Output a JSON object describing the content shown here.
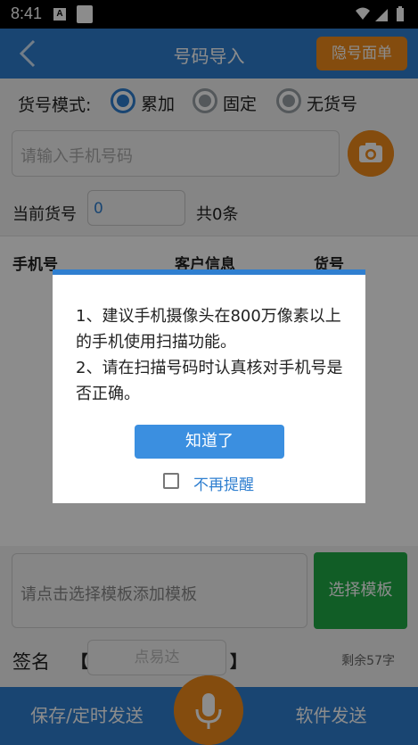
{
  "status_bar": {
    "time": "8:41",
    "notification_letter": "A"
  },
  "header": {
    "title": "号码导入",
    "hide_button": "隐号面单"
  },
  "mode": {
    "label": "货号模式:",
    "options": [
      {
        "label": "累加",
        "checked": true
      },
      {
        "label": "固定",
        "checked": false
      },
      {
        "label": "无货号",
        "checked": false
      }
    ]
  },
  "phone": {
    "placeholder": "请输入手机号码"
  },
  "goods": {
    "label": "当前货号",
    "value": "0",
    "count": "共0条"
  },
  "table": {
    "columns": [
      "手机号",
      "客户信息",
      "货号"
    ]
  },
  "template": {
    "placeholder": "请点击选择模板添加模板",
    "choose_button": "选择模板"
  },
  "sign": {
    "label": "签名",
    "bracket_left": "【",
    "bracket_right": "】",
    "placeholder": "点易达",
    "remaining": "剩余57字"
  },
  "bottom": {
    "save_button": "保存/定时发送",
    "send_button": "软件发送"
  },
  "dialog": {
    "line1": "1、建议手机摄像头在800万像素以上的手机使用扫描功能。",
    "line2": "2、请在扫描号码时认真核对手机号是否正确。",
    "ok_button": "知道了",
    "checkbox_label": "不再提醒"
  },
  "colors": {
    "primary": "#2f7fd0",
    "orange": "#f08a1b",
    "green": "#1faa45"
  }
}
